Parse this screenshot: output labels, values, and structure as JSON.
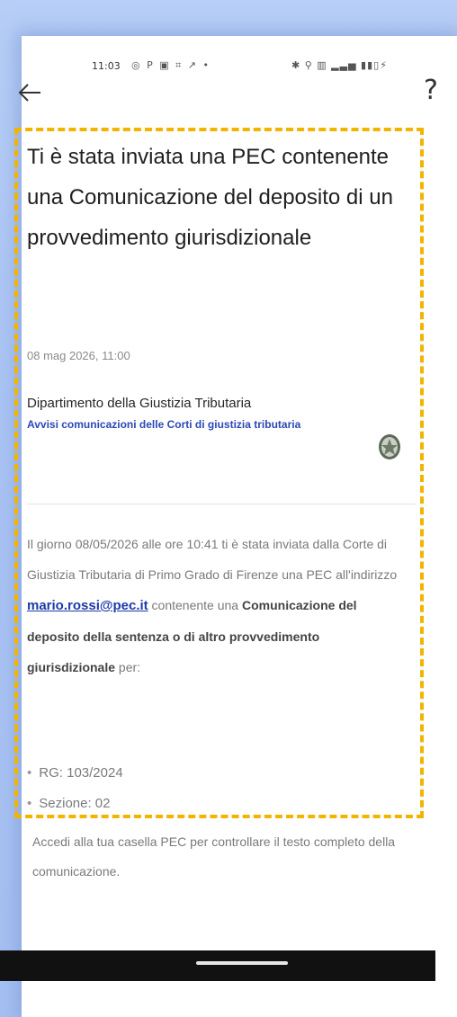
{
  "status_bar": {
    "time": "11:03",
    "left_icons": "◎ P ▣ ⌗ ↗ •",
    "right_icons": "✱ ⚲ ▥ ▂▃▅ ▮▮▯⚡"
  },
  "header": {
    "help_label": "?"
  },
  "notification": {
    "title": "Ti è stata inviata una PEC contenente una Comunicazione del deposito di un provvedimento giurisdizionale",
    "date": "08 mag 2026, 11:00",
    "sender_name": "Dipartimento della Giustizia Tributaria",
    "sender_service": "Avvisi comunicazioni delle Corti di giustizia tributaria",
    "body_part1": "Il giorno 08/05/2026 alle ore 10:41 ti è stata inviata dalla Corte di Giustizia Tributaria di Primo Grado di Firenze una PEC all'indirizzo ",
    "email": "mario.rossi@pec.it",
    "body_part2": " contenente una ",
    "body_strong": "Comunicazione del deposito della sentenza o di altro provvedimento giurisdizionale",
    "body_part3": " per:",
    "details": [
      "RG: 103/2024",
      "Sezione: 02"
    ]
  },
  "footer": {
    "text": "Accedi alla tua casella PEC per controllare il testo completo della comunicazione."
  },
  "colors": {
    "highlight": "#f3b400",
    "link": "#1d3aa8",
    "background_frame": "#a9c3f3"
  }
}
